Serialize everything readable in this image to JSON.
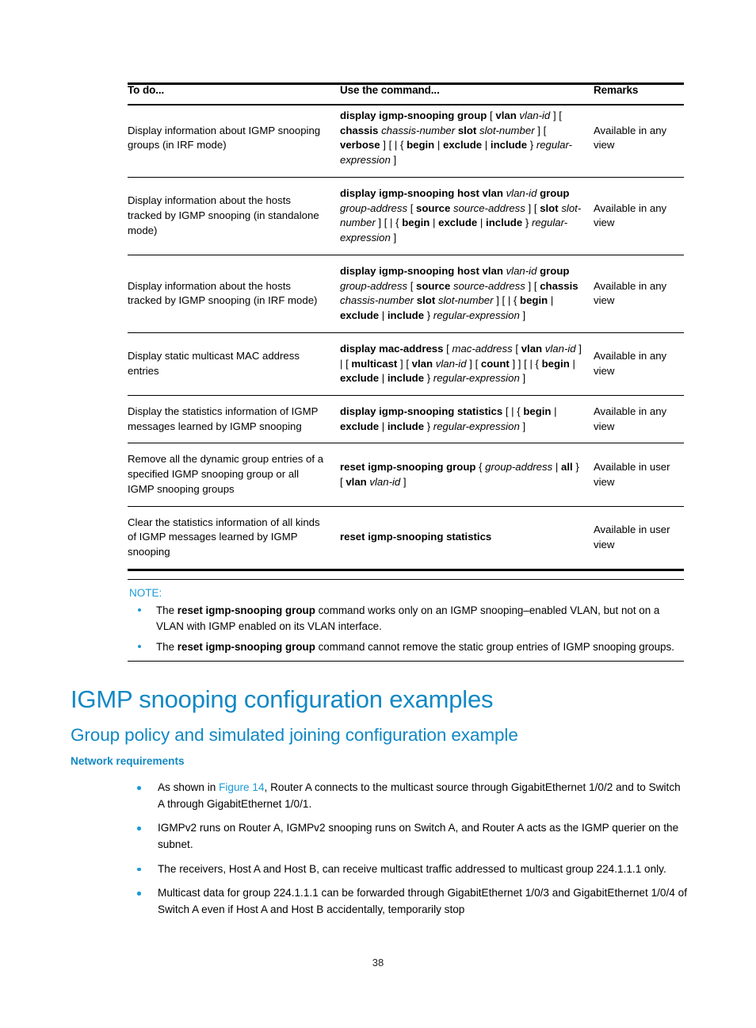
{
  "table": {
    "headers": {
      "todo": "To do...",
      "command": "Use the command...",
      "remarks": "Remarks"
    },
    "rows": [
      {
        "todo": "Display information about IGMP snooping groups (in IRF mode)",
        "command_plain": "display igmp-snooping group [ vlan vlan-id ] [ chassis chassis-number slot slot-number ] [ verbose ] [ | { begin | exclude | include } regular-expression ]",
        "remarks": "Available in any view"
      },
      {
        "todo": "Display information about the hosts tracked by IGMP snooping (in standalone mode)",
        "command_plain": "display igmp-snooping host vlan vlan-id group group-address [ source source-address ] [ slot slot-number ] [ | { begin | exclude | include } regular-expression ]",
        "remarks": "Available in any view"
      },
      {
        "todo": "Display information about the hosts tracked by IGMP snooping (in IRF mode)",
        "command_plain": "display igmp-snooping host vlan vlan-id group group-address [ source source-address ] [ chassis chassis-number slot slot-number ] [ | { begin | exclude | include } regular-expression ]",
        "remarks": "Available in any view"
      },
      {
        "todo": "Display static multicast MAC address entries",
        "command_plain": "display mac-address [ mac-address [ vlan vlan-id ] | [ multicast ] [ vlan vlan-id ] [ count ] ] [ | { begin | exclude | include } regular-expression ]",
        "remarks": "Available in any view"
      },
      {
        "todo": "Display the statistics information of IGMP messages learned by IGMP snooping",
        "command_plain": "display igmp-snooping statistics [ | { begin | exclude | include } regular-expression ]",
        "remarks": "Available in any view"
      },
      {
        "todo": "Remove all the dynamic group entries of a specified IGMP snooping group or all IGMP snooping groups",
        "command_plain": "reset igmp-snooping group { group-address | all } [ vlan vlan-id ]",
        "remarks": "Available in user view"
      },
      {
        "todo": "Clear the statistics information of all kinds of IGMP messages learned by IGMP snooping",
        "command_plain": "reset igmp-snooping statistics",
        "remarks": "Available in user view"
      }
    ]
  },
  "note": {
    "title": "NOTE:",
    "items": [
      {
        "pre": "The ",
        "bold": "reset igmp-snooping group",
        "post": " command works only on an IGMP snooping–enabled VLAN, but not on a VLAN with IGMP enabled on its VLAN interface."
      },
      {
        "pre": "The ",
        "bold": "reset igmp-snooping group",
        "post": " command cannot remove the static group entries of IGMP snooping groups."
      }
    ]
  },
  "headings": {
    "h1": "IGMP snooping configuration examples",
    "h2": "Group policy and simulated joining configuration example",
    "h3": "Network requirements"
  },
  "requirements": [
    {
      "pre": "As shown in ",
      "link": "Figure 14",
      "post": ", Router A connects to the multicast source through GigabitEthernet 1/0/2 and to Switch A through GigabitEthernet 1/0/1."
    },
    {
      "pre": "",
      "link": "",
      "post": "IGMPv2 runs on Router A, IGMPv2 snooping runs on Switch A, and Router A acts as the IGMP querier on the subnet."
    },
    {
      "pre": "",
      "link": "",
      "post": "The receivers, Host A and Host B, can receive multicast traffic addressed to multicast group 224.1.1.1 only."
    },
    {
      "pre": "",
      "link": "",
      "post": "Multicast data for group 224.1.1.1 can be forwarded through GigabitEthernet 1/0/3 and GigabitEthernet 1/0/4 of Switch A even if Host A and Host B accidentally, temporarily stop"
    }
  ],
  "footer": {
    "page_number": "38"
  },
  "colors": {
    "heading_blue": "#1188c4",
    "note_blue": "#1b9ad6",
    "link_blue": "#1b9ad6",
    "rule_black": "#000000"
  }
}
